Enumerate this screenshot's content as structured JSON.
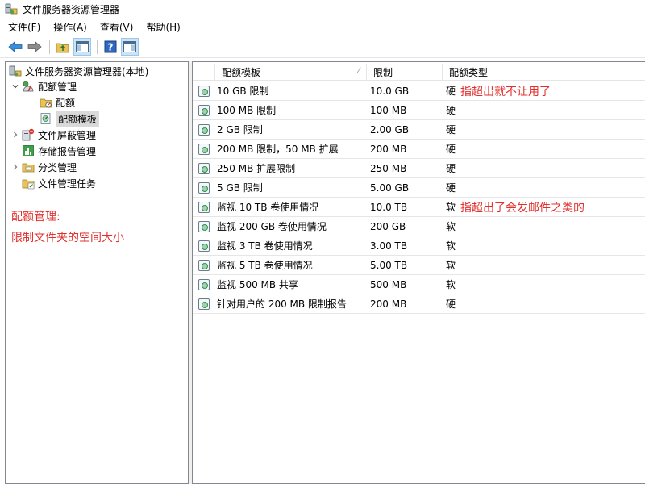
{
  "window": {
    "title": "文件服务器资源管理器"
  },
  "menu": [
    "文件(F)",
    "操作(A)",
    "查看(V)",
    "帮助(H)"
  ],
  "toolbar": {
    "buttons": [
      "back-icon",
      "forward-icon",
      "up-folder-icon",
      "show-tree-icon",
      "help-icon",
      "action-pane-icon"
    ]
  },
  "tree": {
    "root": "文件服务器资源管理器(本地)",
    "quota_mgmt": "配额管理",
    "quotas": "配额",
    "quota_templates": "配额模板",
    "file_screening": "文件屏蔽管理",
    "storage_reports": "存储报告管理",
    "classification": "分类管理",
    "file_mgmt_tasks": "文件管理任务"
  },
  "left_note": {
    "line1": "配额管理:",
    "line2": "限制文件夹的空间大小"
  },
  "table": {
    "headers": {
      "template": "配额模板",
      "limit": "限制",
      "type": "配额类型"
    },
    "rows": [
      {
        "name": "10 GB 限制",
        "limit": "10.0 GB",
        "type": "硬",
        "note": "指超出就不让用了"
      },
      {
        "name": "100 MB 限制",
        "limit": "100 MB",
        "type": "硬",
        "note": ""
      },
      {
        "name": "2 GB 限制",
        "limit": "2.00 GB",
        "type": "硬",
        "note": ""
      },
      {
        "name": "200 MB 限制，50 MB 扩展",
        "limit": "200 MB",
        "type": "硬",
        "note": ""
      },
      {
        "name": "250 MB 扩展限制",
        "limit": "250 MB",
        "type": "硬",
        "note": ""
      },
      {
        "name": "5 GB 限制",
        "limit": "5.00 GB",
        "type": "硬",
        "note": ""
      },
      {
        "name": "监视 10 TB 卷使用情况",
        "limit": "10.0 TB",
        "type": "软",
        "note": "指超出了会发邮件之类的"
      },
      {
        "name": "监视 200 GB 卷使用情况",
        "limit": "200 GB",
        "type": "软",
        "note": ""
      },
      {
        "name": "监视 3 TB 卷使用情况",
        "limit": "3.00 TB",
        "type": "软",
        "note": ""
      },
      {
        "name": "监视 5 TB 卷使用情况",
        "limit": "5.00 TB",
        "type": "软",
        "note": ""
      },
      {
        "name": "监视 500 MB 共享",
        "limit": "500 MB",
        "type": "软",
        "note": ""
      },
      {
        "name": "针对用户的 200 MB 限制报告",
        "limit": "200 MB",
        "type": "硬",
        "note": ""
      }
    ]
  }
}
